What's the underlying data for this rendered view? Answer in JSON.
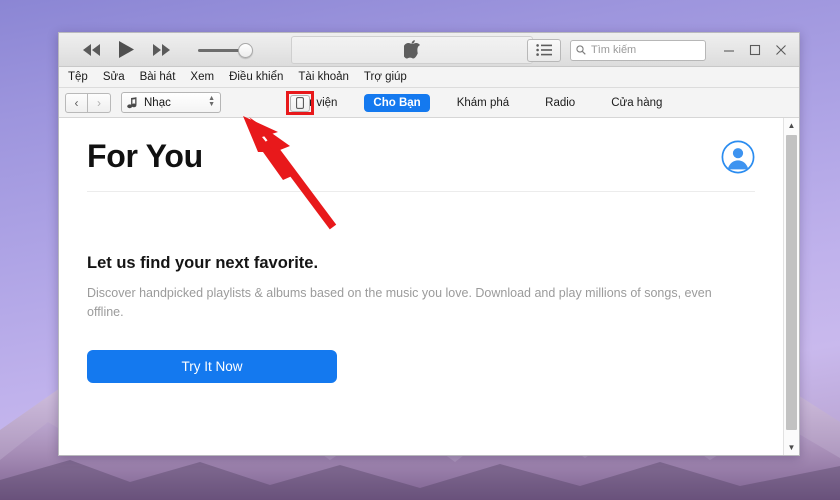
{
  "window": {
    "titlebar": {
      "transport": [
        {
          "name": "previous-track-button",
          "icon": "rewind-icon"
        },
        {
          "name": "play-button",
          "icon": "play-icon"
        },
        {
          "name": "next-track-button",
          "icon": "fast-forward-icon"
        }
      ],
      "volume": {
        "name": "volume-slider",
        "value": 100
      },
      "status_panel": {
        "icon": "apple-logo-icon"
      },
      "list_button_icon": "list-view-icon",
      "search": {
        "placeholder": "Tìm kiếm",
        "value": "",
        "icon": "search-icon"
      },
      "window_controls": [
        {
          "name": "minimize-button",
          "glyph": "—"
        },
        {
          "name": "maximize-button",
          "glyph": "▢"
        },
        {
          "name": "close-button",
          "glyph": "✕"
        }
      ]
    },
    "menubar": {
      "items": [
        {
          "label": "Tệp"
        },
        {
          "label": "Sửa"
        },
        {
          "label": "Bài hát"
        },
        {
          "label": "Xem"
        },
        {
          "label": "Điều khiển"
        },
        {
          "label": "Tài khoản"
        },
        {
          "label": "Trợ giúp"
        }
      ]
    },
    "navbar": {
      "back_glyph": "‹",
      "forward_glyph": "›",
      "source_select": {
        "label": "Nhạc",
        "icon": "music-note-icon"
      },
      "device_button": {
        "icon": "device-iphone-icon",
        "highlighted": true,
        "highlight_color": "#e8191b"
      },
      "tabs": [
        {
          "label": "Thư viện",
          "active": false
        },
        {
          "label": "Cho Bạn",
          "active": true
        },
        {
          "label": "Khám phá",
          "active": false
        },
        {
          "label": "Radio",
          "active": false
        },
        {
          "label": "Cửa hàng",
          "active": false
        }
      ]
    },
    "content": {
      "page_title": "For You",
      "account_icon": "account-avatar-icon",
      "promo_heading": "Let us find your next favorite.",
      "promo_body": "Discover handpicked playlists & albums based on the music you love. Download and play millions of songs, even offline.",
      "cta_label": "Try It Now"
    },
    "scrollbar": {
      "up_glyph": "▲",
      "down_glyph": "▼"
    }
  },
  "annotation": {
    "arrow_color": "#e8191b",
    "points_to": "device-button"
  },
  "colors": {
    "accent_blue": "#1479ef",
    "annotation_red": "#e8191b",
    "desktop_purple": "#b0a5e6"
  }
}
